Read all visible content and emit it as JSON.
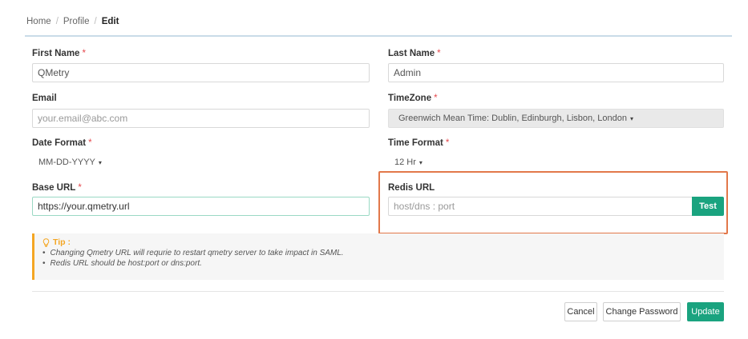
{
  "breadcrumb": {
    "home": "Home",
    "profile": "Profile",
    "edit": "Edit",
    "separator": "/"
  },
  "form": {
    "first_name": {
      "label": "First Name",
      "value": "QMetry",
      "required": "*"
    },
    "last_name": {
      "label": "Last Name",
      "value": "Admin",
      "required": "*"
    },
    "email": {
      "label": "Email",
      "placeholder": "your.email@abc.com"
    },
    "timezone": {
      "label": "TimeZone",
      "value": "Greenwich Mean Time: Dublin, Edinburgh, Lisbon, London",
      "required": "*"
    },
    "date_format": {
      "label": "Date Format",
      "value": "MM-DD-YYYY",
      "required": "*"
    },
    "time_format": {
      "label": "Time Format",
      "value": "12 Hr",
      "required": "*"
    },
    "base_url": {
      "label": "Base URL",
      "value": "https://your.qmetry.url",
      "required": "*"
    },
    "redis_url": {
      "label": "Redis URL",
      "placeholder": "host/dns : port",
      "test_label": "Test"
    }
  },
  "tip": {
    "title": "Tip :",
    "items": [
      "Changing Qmetry URL will requrie to restart qmetry server to take impact in SAML.",
      "Redis URL should be host:port or dns:port."
    ]
  },
  "actions": {
    "cancel": "Cancel",
    "change_password": "Change Password",
    "update": "Update"
  },
  "colors": {
    "accent": "#1aa37f",
    "required": "#e5484d",
    "highlight": "#e2784a",
    "tip": "#f4a623"
  },
  "caret": "▾"
}
